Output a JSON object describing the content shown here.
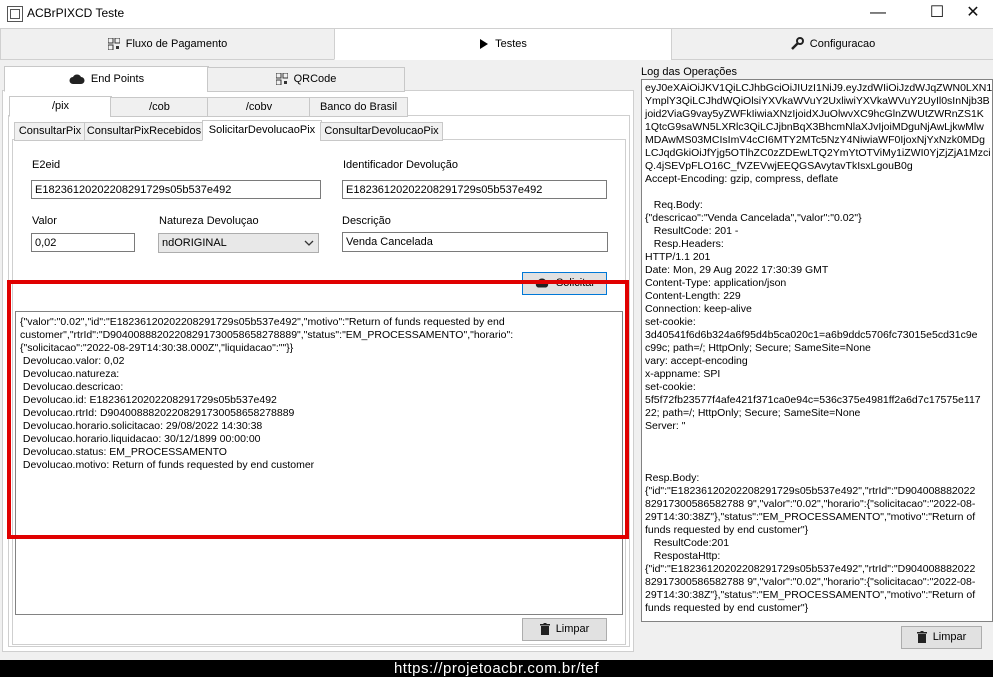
{
  "window": {
    "title": "ACBrPIXCD Teste",
    "minimize": "—",
    "maximize": "☐",
    "close": "✕"
  },
  "main_tabs": [
    {
      "label": "Fluxo de Pagamento",
      "icon": "qr-grid-icon"
    },
    {
      "label": "Testes",
      "icon": "play-icon"
    },
    {
      "label": "Configuracao",
      "icon": "wrench-icon"
    }
  ],
  "sub_tabs": [
    {
      "label": "End Points",
      "icon": "cloud-icon"
    },
    {
      "label": "QRCode",
      "icon": "qr-grid-icon"
    }
  ],
  "endpoint_tabs": [
    "/pix",
    "/cob",
    "/cobv",
    "Banco do Brasil"
  ],
  "pix_tabs": [
    "ConsultarPix",
    "ConsultarPixRecebidos",
    "SolicitarDevolucaoPix",
    "ConsultarDevolucaoPix"
  ],
  "form": {
    "e2eid_label": "E2eid",
    "e2eid_value": "E18236120202208291729s05b537e492",
    "ident_label": "Identificador Devolução",
    "ident_value": "E18236120202208291729s05b537e492",
    "valor_label": "Valor",
    "valor_value": "0,02",
    "natureza_label": "Natureza Devoluçao",
    "natureza_value": "ndORIGINAL",
    "descricao_label": "Descrição",
    "descricao_value": "Venda Cancelada",
    "solicitar_label": "Solicitar",
    "limpar_label": "Limpar"
  },
  "result_lines": [
    "{\"valor\":\"0.02\",\"id\":\"E18236120202208291729s05b537e492\",\"motivo\":\"Return of funds requested by end",
    "customer\",\"rtrId\":\"D90400888202208291730058658278889\",\"status\":\"EM_PROCESSAMENTO\",\"horario\":",
    "{\"solicitacao\":\"2022-08-29T14:30:38.000Z\",\"liquidacao\":\"\"}}",
    " Devolucao.valor: 0,02",
    " Devolucao.natureza:",
    " Devolucao.descricao:",
    " Devolucao.id: E18236120202208291729s05b537e492",
    " Devolucao.rtrId: D90400888202208291730058658278889",
    " Devolucao.horario.solicitacao: 29/08/2022 14:30:38",
    " Devolucao.horario.liquidacao: 30/12/1899 00:00:00",
    " Devolucao.status: EM_PROCESSAMENTO",
    " Devolucao.motivo: Return of funds requested by end customer"
  ],
  "log": {
    "label": "Log das Operações",
    "limpar_label": "Limpar",
    "lines": [
      "eyJ0eXAiOiJKV1QiLCJhbGciOiJIUzI1NiJ9.eyJzdWIiOiJzdWJqZWN0LXN1",
      "YmplY3QiLCJhdWQiOlsiYXVkaWVuY2UxliwiYXVkaWVuY2UyIl0sInNjb3B",
      "joid2ViaG9vay5yZWFkIiwiaXNzIjoidXJuOlwvXC9hcGlnZWUtZWRnZS1K",
      "1QtcG9saWN5LXRlc3QiLCJjbnBqX3BhcmNlaXJvIjoiMDguNjAwLjkwMlw",
      "MDAwMS03MCIsImV4cCI6MTY2MTc5NzY4NiwiaWF0IjoxNjYxNzk0MDg",
      "LCJqdGkiOiJfYjg5OTlhZC0zZDEwLTQ2YmYtOTViMy1iZWI0YjZjZjA1Mzci",
      "Q.4jSEVpFLO16C_fVZEVwjEEQGSAvytavTkIsxLgouB0g",
      "Accept-Encoding: gzip, compress, deflate",
      "",
      "   Req.Body:",
      "{\"descricao\":\"Venda Cancelada\",\"valor\":\"0.02\"}",
      "   ResultCode: 201 -",
      "   Resp.Headers:",
      "HTTP/1.1 201",
      "Date: Mon, 29 Aug 2022 17:30:39 GMT",
      "Content-Type: application/json",
      "Content-Length: 229",
      "Connection: keep-alive",
      "set-cookie:",
      "3d40541f6d6b324a6f95d4b5ca020c1=a6b9ddc5706fc73015e5cd31c9e",
      "c99c; path=/; HttpOnly; Secure; SameSite=None",
      "vary: accept-encoding",
      "x-appname: SPI",
      "set-cookie:",
      "5f5f72fb23577f4afe421f371ca0e94c=536c375e4981ff2a6d7c17575e117",
      "22; path=/; HttpOnly; Secure; SameSite=None",
      "Server: \"",
      "",
      "",
      "",
      "Resp.Body:",
      "{\"id\":\"E18236120202208291729s05b537e492\",\"rtrId\":\"D904008882022",
      "82917300586582788 9\",\"valor\":\"0.02\",\"horario\":{\"solicitacao\":\"2022-08-",
      "29T14:30:38Z\"},\"status\":\"EM_PROCESSAMENTO\",\"motivo\":\"Return of",
      "funds requested by end customer\"}",
      "   ResultCode:201",
      "   RespostaHttp:",
      "{\"id\":\"E18236120202208291729s05b537e492\",\"rtrId\":\"D904008882022",
      "82917300586582788 9\",\"valor\":\"0.02\",\"horario\":{\"solicitacao\":\"2022-08-",
      "29T14:30:38Z\"},\"status\":\"EM_PROCESSAMENTO\",\"motivo\":\"Return of",
      "funds requested by end customer\"}"
    ]
  },
  "footer": {
    "url": "https://projetoacbr.com.br/tef"
  },
  "colors": {
    "highlight": "#e00000",
    "accent": "#0078d7"
  }
}
